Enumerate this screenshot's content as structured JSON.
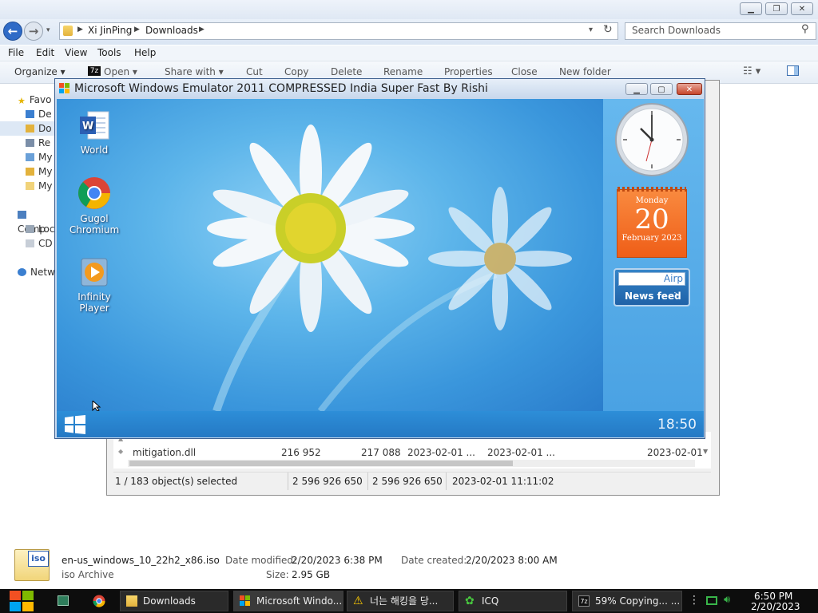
{
  "explorer": {
    "breadcrumb": [
      "Xi JinPing",
      "Downloads"
    ],
    "search_placeholder": "Search Downloads",
    "menu": [
      "File",
      "Edit",
      "View",
      "Tools",
      "Help"
    ],
    "commands": [
      "Organize ▾",
      "Open ▾",
      "Share with ▾",
      "Cut",
      "Copy",
      "Delete",
      "Rename",
      "Properties",
      "Close",
      "New folder"
    ],
    "nav": {
      "favorites": "Favo",
      "fav_items": [
        "De",
        "Do",
        "Re",
        "My",
        "My",
        "My"
      ],
      "computer": "Comp",
      "comp_items": [
        "Loc",
        "CD"
      ],
      "network": "Netw"
    }
  },
  "zip": {
    "rows": [
      {
        "name": "mitigation.dll",
        "size": "216 952",
        "packed": "217 088",
        "modified": "2023-02-01 ...",
        "created": "2023-02-01 ...",
        "accessed": "2023-02-01"
      }
    ],
    "status": {
      "selected": "1 / 183 object(s) selected",
      "size": "2 596 926 650",
      "packed": "2 596 926 650",
      "date": "2023-02-01 11:11:02"
    }
  },
  "emulator": {
    "title": "Microsoft Windows Emulator 2011 COMPRESSED India Super Fast By Rishi",
    "desktop_icons": [
      {
        "label": "World",
        "icon": "word-icon"
      },
      {
        "label": "Gugol Chromium",
        "icon": "chrome-icon"
      },
      {
        "label": "Infinity Player",
        "icon": "media-player-icon"
      }
    ],
    "calendar": {
      "weekday": "Monday",
      "day": "20",
      "month": "February 2023"
    },
    "news": {
      "input": "Airp",
      "label": "News feed"
    },
    "clock_time": "18:50"
  },
  "details": {
    "filename": "en-us_windows_10_22h2_x86.iso",
    "type": "iso Archive",
    "modified_label": "Date modified:",
    "modified": "2/20/2023 6:38 PM",
    "created_label": "Date created:",
    "created": "2/20/2023 8:00 AM",
    "size_label": "Size:",
    "size": "2.95 GB",
    "icon_text": "iso"
  },
  "taskbar": {
    "tasks": [
      "Downloads",
      "Microsoft Windo...",
      "너는 해킹을 당...",
      "ICQ",
      "59% Copying... ..."
    ],
    "time": "6:50 PM",
    "date": "2/20/2023"
  },
  "colors": {
    "accent": "#3a96dc",
    "calendar": "#f36b21"
  }
}
